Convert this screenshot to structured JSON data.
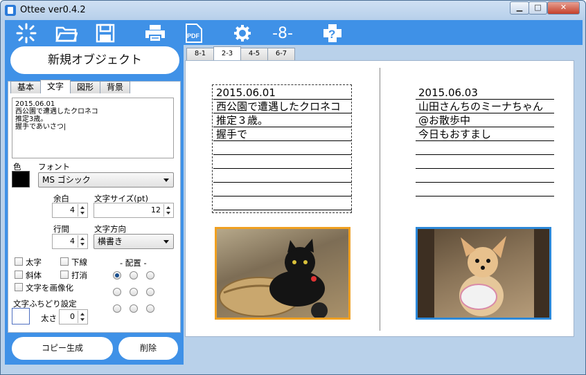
{
  "window": {
    "title": "Ottee ver0.4.2",
    "minimize_label": "▁",
    "maximize_label": "□",
    "close_label": "✕"
  },
  "toolbar": {
    "icons": [
      "new-icon",
      "open-folder-icon",
      "save-icon",
      "print-icon",
      "pdf-icon",
      "settings-gear-icon",
      "page-number-icon",
      "help-icon"
    ],
    "pdf_label": "PDF",
    "page_number_label": "-8-",
    "help_label": "?"
  },
  "left_panel": {
    "new_object_label": "新規オブジェクト",
    "tabs": [
      "基本",
      "文字",
      "図形",
      "背景"
    ],
    "active_tab": "文字",
    "text_content": "2015.06.01\n西公園で遭遇したクロネコ\n推定3歳。\n握手であいさつ|",
    "color_label": "色",
    "font_label": "フォント",
    "font_value": "MS ゴシック",
    "margin_label": "余白",
    "margin_value": "4",
    "font_size_label": "文字サイズ(pt)",
    "font_size_value": "12",
    "line_spacing_label": "行間",
    "line_spacing_value": "4",
    "direction_label": "文字方向",
    "direction_value": "横書き",
    "bold_label": "太字",
    "underline_label": "下線",
    "italic_label": "斜体",
    "strike_label": "打消",
    "rasterize_label": "文字を画像化",
    "alignment_label": "- 配置 -",
    "outline_label": "文字ふちどり設定",
    "thickness_label": "太さ",
    "thickness_value": "0",
    "copy_button": "コピー生成",
    "delete_button": "削除"
  },
  "preview": {
    "page_tabs": [
      "8-1",
      "2-3",
      "4-5",
      "6-7"
    ],
    "active_page_tab": "2-3",
    "left_page": {
      "lines": [
        "2015.06.01",
        "西公園で遭遇したクロネコ",
        "推定３歳。",
        "握手で",
        "",
        "",
        "",
        "",
        ""
      ]
    },
    "right_page": {
      "lines": [
        "2015.06.03",
        "山田さんちのミーナちゃん",
        "@お散歩中",
        "今日もおすまし",
        "",
        "",
        "",
        ""
      ]
    },
    "left_photo_subject": "black cat in basket",
    "right_photo_subject": "small dog sitting"
  }
}
